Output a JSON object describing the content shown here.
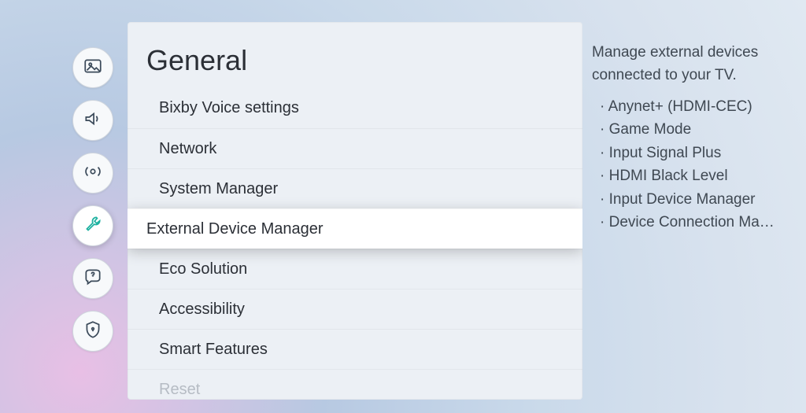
{
  "sidebar": {
    "items": [
      {
        "name": "picture",
        "selected": false
      },
      {
        "name": "sound",
        "selected": false
      },
      {
        "name": "broadcasting",
        "selected": false
      },
      {
        "name": "general",
        "selected": true
      },
      {
        "name": "support",
        "selected": false
      },
      {
        "name": "privacy",
        "selected": false
      }
    ]
  },
  "panel": {
    "title": "General",
    "menu": [
      {
        "label": "Bixby Voice settings",
        "selected": false
      },
      {
        "label": "Network",
        "selected": false
      },
      {
        "label": "System Manager",
        "selected": false
      },
      {
        "label": "External Device Manager",
        "selected": true
      },
      {
        "label": "Eco Solution",
        "selected": false
      },
      {
        "label": "Accessibility",
        "selected": false
      },
      {
        "label": "Smart Features",
        "selected": false
      },
      {
        "label": "Reset",
        "selected": false,
        "disabled": true
      }
    ]
  },
  "description": {
    "text": "Manage external devices connected to your TV.",
    "items": [
      "Anynet+ (HDMI-CEC)",
      "Game Mode",
      "Input Signal Plus",
      "HDMI Black Level",
      "Input Device Manager",
      "Device Connection Manager"
    ]
  }
}
